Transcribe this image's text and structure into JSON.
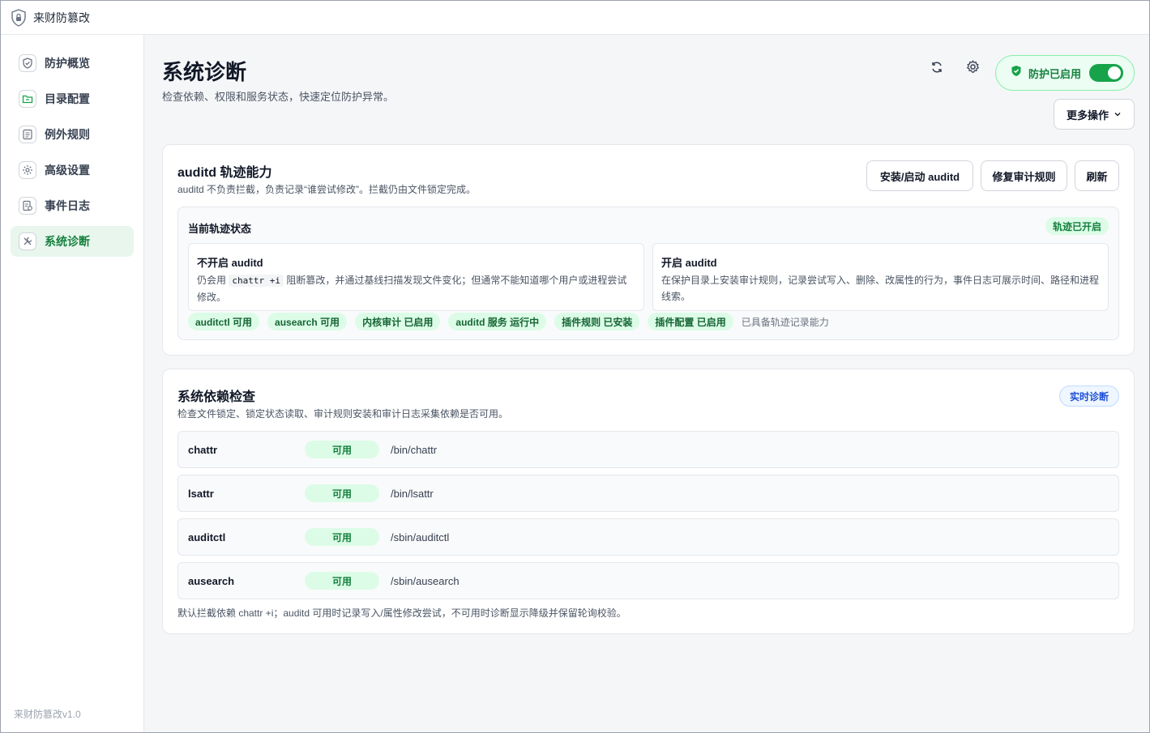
{
  "window": {
    "title": "来财防篡改"
  },
  "sidebar": {
    "items": [
      {
        "label": "防护概览",
        "icon": "shield-icon",
        "active": false
      },
      {
        "label": "目录配置",
        "icon": "folder-icon",
        "active": false
      },
      {
        "label": "例外规则",
        "icon": "list-icon",
        "active": false
      },
      {
        "label": "高级设置",
        "icon": "gear-icon",
        "active": false
      },
      {
        "label": "事件日志",
        "icon": "log-icon",
        "active": false
      },
      {
        "label": "系统诊断",
        "icon": "tools-icon",
        "active": true
      }
    ],
    "version": "来财防篡改v1.0"
  },
  "header": {
    "title": "系统诊断",
    "subtitle": "检查依赖、权限和服务状态，快速定位防护异常。",
    "protection_label": "防护已启用",
    "protection_enabled": true,
    "more_label": "更多操作"
  },
  "auditd_card": {
    "title": "auditd 轨迹能力",
    "desc": "auditd 不负责拦截，负责记录“谁尝试修改”。拦截仍由文件锁定完成。",
    "buttons": {
      "install": "安装/启动 auditd",
      "repair": "修复审计规则",
      "refresh": "刷新"
    },
    "panel": {
      "title": "当前轨迹状态",
      "status": "轨迹已开启",
      "off": {
        "title": "不开启 auditd",
        "desc_before": "仍会用",
        "code": "chattr +i",
        "desc_after": "阻断篡改，并通过基线扫描发现文件变化；但通常不能知道哪个用户或进程尝试修改。"
      },
      "on": {
        "title": "开启 auditd",
        "desc": "在保护目录上安装审计规则，记录尝试写入、删除、改属性的行为，事件日志可展示时间、路径和进程线索。"
      },
      "tags": [
        "auditctl 可用",
        "ausearch 可用",
        "内核审计 已启用",
        "auditd 服务 运行中",
        "插件规则 已安装",
        "插件配置 已启用"
      ],
      "tags_note": "已具备轨迹记录能力"
    }
  },
  "deps_card": {
    "title": "系统依赖检查",
    "desc": "检查文件锁定、锁定状态读取、审计规则安装和审计日志采集依赖是否可用。",
    "realtime_label": "实时诊断",
    "rows": [
      {
        "name": "chattr",
        "status": "可用",
        "path": "/bin/chattr"
      },
      {
        "name": "lsattr",
        "status": "可用",
        "path": "/bin/lsattr"
      },
      {
        "name": "auditctl",
        "status": "可用",
        "path": "/sbin/auditctl"
      },
      {
        "name": "ausearch",
        "status": "可用",
        "path": "/sbin/ausearch"
      }
    ],
    "footnote": "默认拦截依赖 chattr +i；auditd 可用时记录写入/属性修改尝试，不可用时诊断显示降级并保留轮询校验。"
  },
  "colors": {
    "accent": "#16a34a",
    "accent_bg": "#dcfce7",
    "info": "#1d4ed8"
  }
}
